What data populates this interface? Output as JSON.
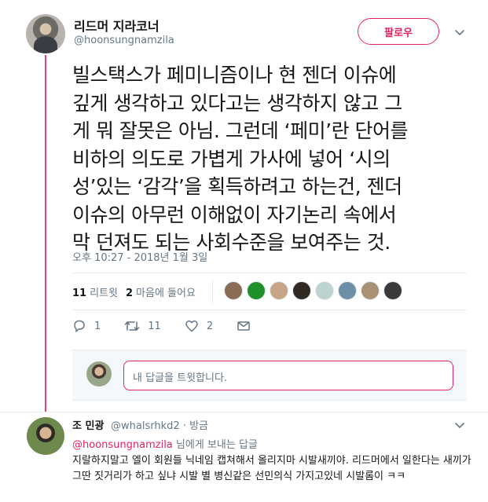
{
  "tweet": {
    "display_name": "리드머 지라코너",
    "handle": "@hoonsungnamzila",
    "follow_label": "팔로우",
    "text_lines": [
      "빌스택스가 페미니즘이나 현 젠더 이슈에",
      "깊게 생각하고 있다고는 생각하지 않고 그",
      "게 뭐 잘못은 아님. 그런데 ‘페미’란 단어를",
      "비하의 의도로 가볍게 가사에 넣어 ‘시의",
      "성’있는 ‘감각’을 획득하려고 하는건, 젠더",
      "이슈의 아무런 이해없이 자기논리 속에서",
      "막 던져도 되는 사회수준을 보여주는 것."
    ],
    "timestamp": "오후 10:27 - 2018년 1월 3일",
    "retweets_count": "11",
    "retweets_label": "리트윗",
    "likes_count": "2",
    "likes_label": "마음에 들어요",
    "actions": {
      "reply_count": "1",
      "retweet_count": "11",
      "like_count": "2"
    },
    "reply_placeholder": "내 답글을 트윗합니다."
  },
  "likers": [
    "#8a6b55",
    "#1f8f2a",
    "#c7a586",
    "#2f2b22",
    "#bcd3d0",
    "#6e8fa8",
    "#a89273",
    "#3a3a3a"
  ],
  "reply": {
    "name": "조 민광",
    "handle": "@whalsrhkd2",
    "time": "방금",
    "meta_sep": "·",
    "mention": "@hoonsungnamzila",
    "replying_suffix": " 님에게 보내는 답글",
    "text": "지랄하지말고 엘이 회원들 닉네임 캡쳐해서 올리지마 시발새끼야. 리드머에서 일한다는 새끼가 그딴 짓거리가 하고 싶냐 시발 별 병신같은 선민의식 가지고있네 시발롬이 ㅋㅋ"
  },
  "colors": {
    "accent": "#e0245e",
    "secondary_text": "#657786",
    "border": "#e6ecf0"
  }
}
